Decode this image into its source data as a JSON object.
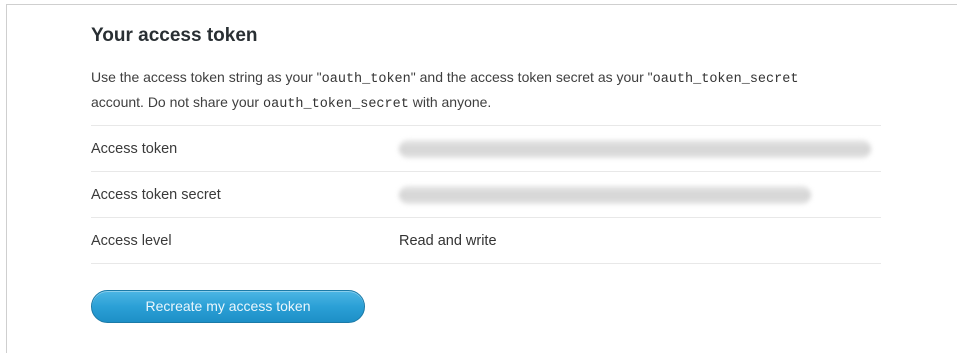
{
  "section": {
    "title": "Your access token",
    "description": {
      "line1_prefix": "Use the access token string as your \"",
      "line1_code1": "oauth_token",
      "line1_mid": "\" and the access token secret as your \"",
      "line1_code2": "oauth_token_secret",
      "line2_prefix": "account. Do not share your ",
      "line2_code": "oauth_token_secret",
      "line2_suffix": " with anyone."
    }
  },
  "rows": [
    {
      "label": "Access token",
      "value": "",
      "redacted": true
    },
    {
      "label": "Access token secret",
      "value": "",
      "redacted": true
    },
    {
      "label": "Access level",
      "value": "Read and write",
      "redacted": false
    }
  ],
  "actions": {
    "recreate_label": "Recreate my access token"
  },
  "colors": {
    "button_top": "#4cb6e4",
    "button_bottom": "#1d8fc7",
    "button_text": "#eaf6fc"
  }
}
